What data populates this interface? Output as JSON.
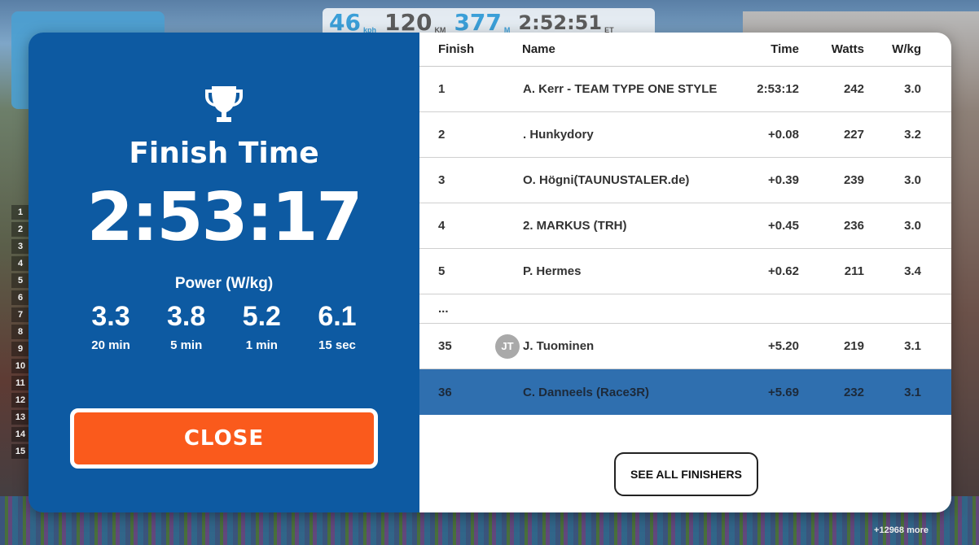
{
  "hud": {
    "speed": "46",
    "speed_unit": "kph",
    "distance": "120",
    "distance_unit": "KM",
    "power": "377",
    "power_unit": "M",
    "elapsed": "2:52:51",
    "elapsed_unit": "ET"
  },
  "background": {
    "rider_ranks": [
      "1",
      "2",
      "3",
      "4",
      "5",
      "6",
      "7",
      "8",
      "9",
      "10",
      "11",
      "12",
      "13",
      "14",
      "15"
    ],
    "more_riders": "+12968 more"
  },
  "summary": {
    "title": "Finish Time",
    "finish_time": "2:53:17",
    "power_label": "Power (W/kg)",
    "power": [
      {
        "value": "3.3",
        "duration": "20 min"
      },
      {
        "value": "3.8",
        "duration": "5 min"
      },
      {
        "value": "5.2",
        "duration": "1 min"
      },
      {
        "value": "6.1",
        "duration": "15 sec"
      }
    ],
    "close_label": "CLOSE"
  },
  "results": {
    "headers": {
      "finish": "Finish",
      "name": "Name",
      "time": "Time",
      "watts": "Watts",
      "wkg": "W/kg"
    },
    "rows": [
      {
        "finish": "1",
        "avatar": "",
        "name": "A. Kerr - TEAM TYPE ONE STYLE",
        "time": "2:53:12",
        "watts": "242",
        "wkg": "3.0"
      },
      {
        "finish": "2",
        "avatar": "",
        "name": ". Hunkydory",
        "time": "+0.08",
        "watts": "227",
        "wkg": "3.2"
      },
      {
        "finish": "3",
        "avatar": "",
        "name": "O. Högni(TAUNUSTALER.de)",
        "time": "+0.39",
        "watts": "239",
        "wkg": "3.0"
      },
      {
        "finish": "4",
        "avatar": "",
        "name": "2. MARKUS (TRH)",
        "time": "+0.45",
        "watts": "236",
        "wkg": "3.0"
      },
      {
        "finish": "5",
        "avatar": "",
        "name": "P. Hermes",
        "time": "+0.62",
        "watts": "211",
        "wkg": "3.4"
      }
    ],
    "ellipsis": "...",
    "nearby_rows": [
      {
        "finish": "35",
        "avatar": "JT",
        "name": "J. Tuominen",
        "time": "+5.20",
        "watts": "219",
        "wkg": "3.1"
      },
      {
        "finish": "36",
        "avatar": "",
        "name": "C. Danneels (Race3R)",
        "time": "+5.69",
        "watts": "232",
        "wkg": "3.1"
      }
    ],
    "see_all_label": "SEE ALL FINISHERS"
  }
}
